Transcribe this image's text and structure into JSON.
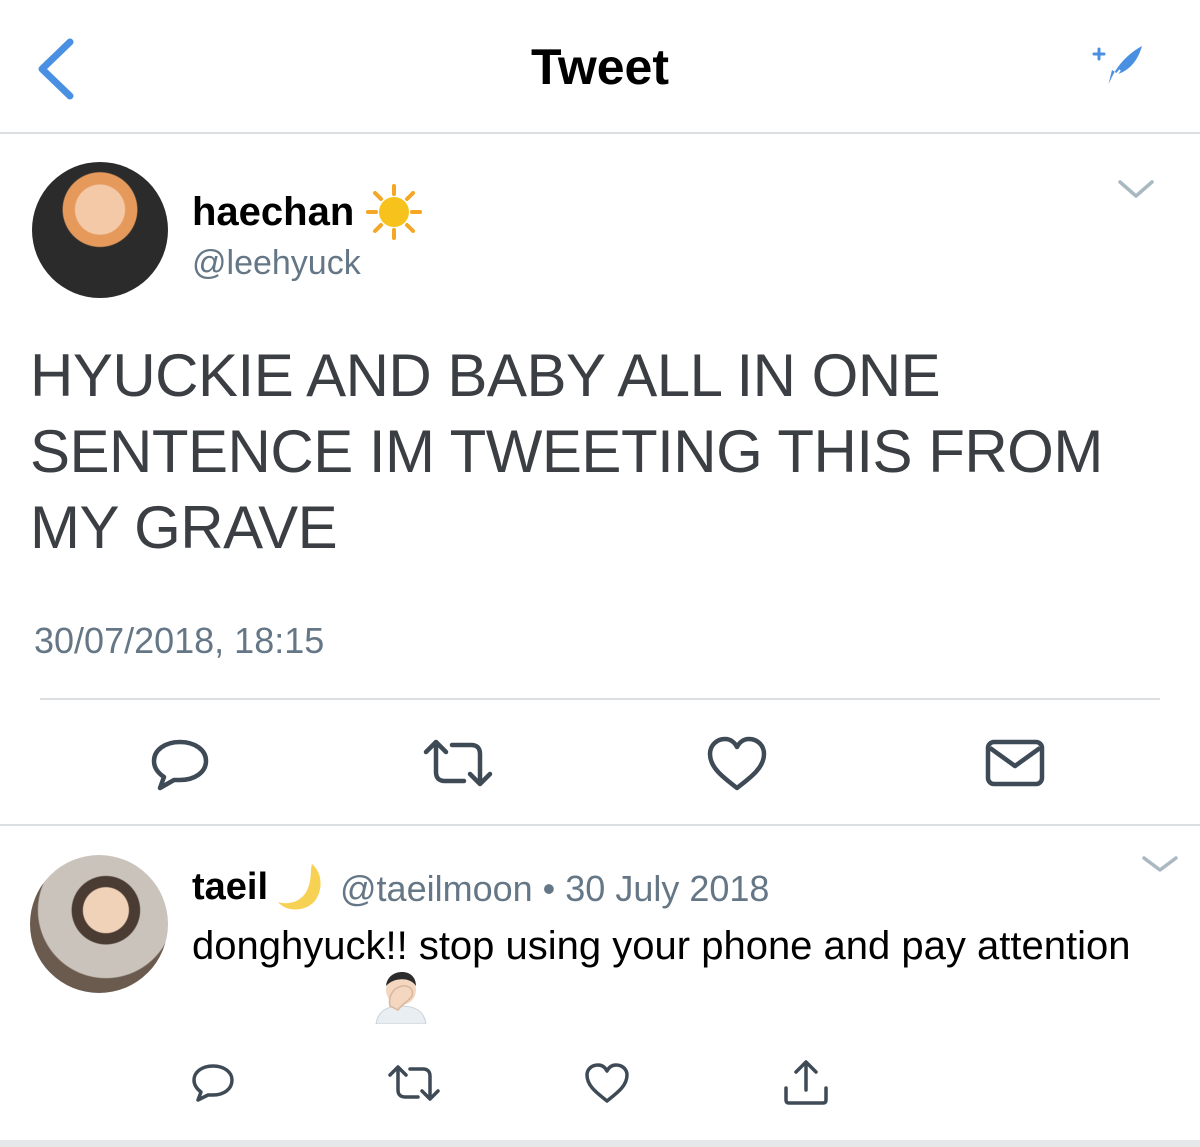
{
  "colors": {
    "accent": "#4a90e2",
    "icon_gray": "#657786",
    "text": "#14171a",
    "divider": "#dcdfe2"
  },
  "header": {
    "title": "Tweet",
    "back_icon": "chevron-left-icon",
    "compose_icon": "compose-feather-icon"
  },
  "main_tweet": {
    "display_name": "haechan",
    "name_emoji": "sun-icon",
    "handle": "@leehyuck",
    "text": "HYUCKIE AND BABY ALL IN ONE SENTENCE IM TWEETING THIS FROM MY GRAVE",
    "timestamp": "30/07/2018, 18:15",
    "actions": [
      "reply-icon",
      "retweet-icon",
      "like-icon",
      "direct-message-icon"
    ]
  },
  "reply_tweet": {
    "display_name": "taeil",
    "name_emoji": "crescent-moon-icon",
    "handle": "@taeilmoon",
    "separator": "•",
    "date": "30 July 2018",
    "text": "donghyuck!! stop using your phone and pay attention",
    "text_emoji": "facepalm-icon",
    "actions": [
      "reply-icon",
      "retweet-icon",
      "like-icon",
      "share-icon"
    ]
  }
}
